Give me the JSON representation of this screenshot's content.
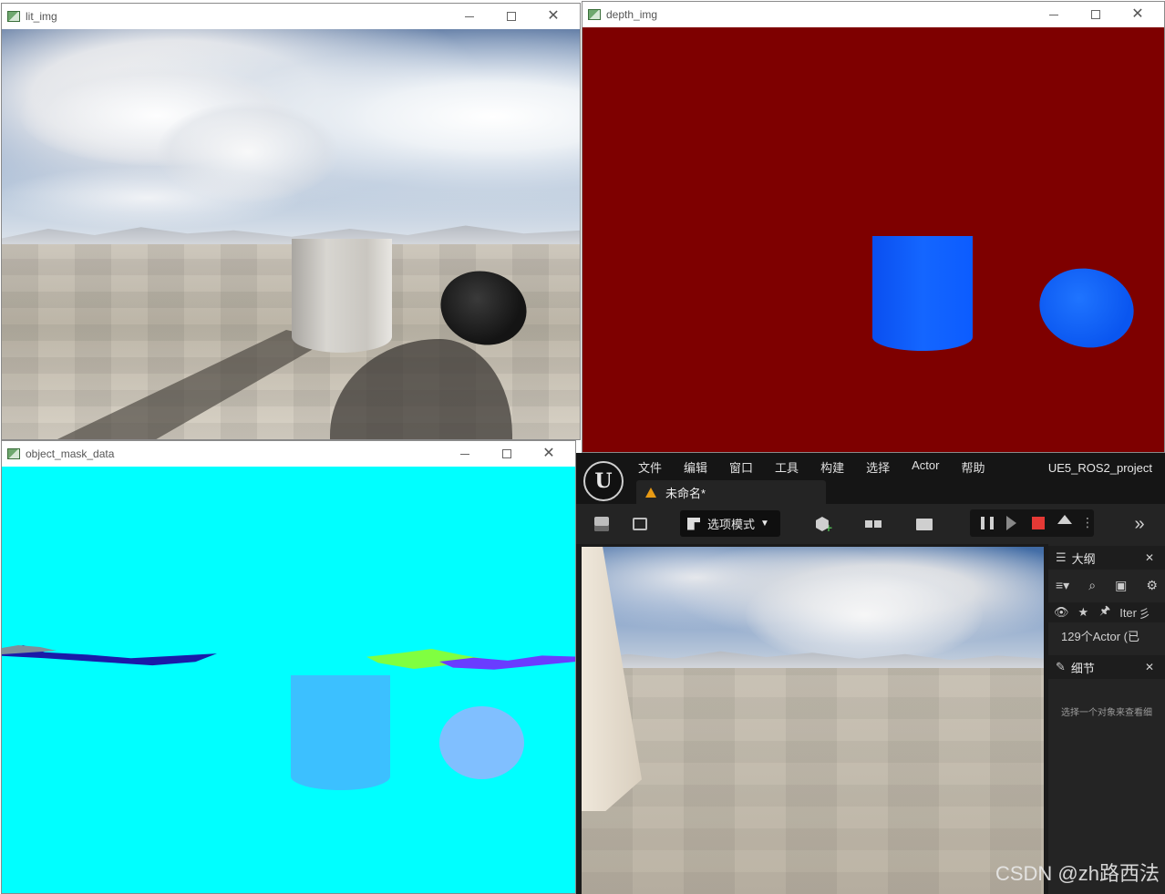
{
  "windows": {
    "lit": {
      "title": "lit_img"
    },
    "depth": {
      "title": "depth_img"
    },
    "mask": {
      "title": "object_mask_data"
    }
  },
  "editor": {
    "menu": [
      "文件",
      "编辑",
      "窗口",
      "工具",
      "构建",
      "选择",
      "Actor",
      "帮助"
    ],
    "project_name": "UE5_ROS2_project",
    "document_tab": "未命名*",
    "mode_button": "选项模式",
    "outliner": {
      "title": "大纲",
      "column_label": "Iter",
      "actor_count": "129个Actor (已",
      "truncated_glyph": "彡"
    },
    "details": {
      "title": "细节",
      "hint": "选择一个对象来查看细"
    }
  },
  "watermark": "CSDN @zh路西法",
  "colors": {
    "depth_background": "#7e0000",
    "depth_object": "#0c5cff",
    "mask_background": "#00ffff",
    "mask_cylinder": "#3cc0ff",
    "mask_sphere": "#80bfff",
    "accent_warning": "#e89a14",
    "stop_button": "#e53935"
  }
}
